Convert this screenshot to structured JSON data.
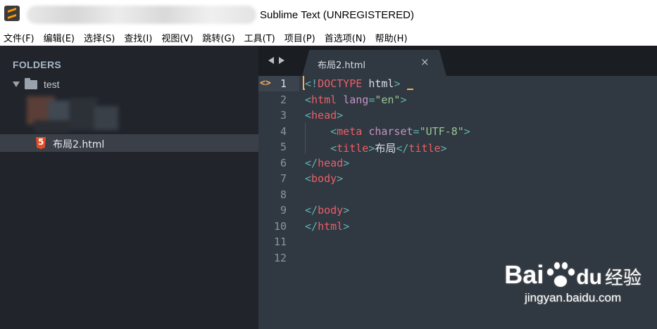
{
  "window": {
    "title": "Sublime Text (UNREGISTERED)"
  },
  "menu": [
    "文件(F)",
    "编辑(E)",
    "选择(S)",
    "查找(I)",
    "视图(V)",
    "跳转(G)",
    "工具(T)",
    "项目(P)",
    "首选项(N)",
    "帮助(H)"
  ],
  "sidebar": {
    "heading": "FOLDERS",
    "folder": "test",
    "file": "布局2.html"
  },
  "tab": {
    "label": "布局2.html",
    "close": "×"
  },
  "editor": {
    "current_line": 1,
    "marker": "<>",
    "line_numbers": [
      "1",
      "2",
      "3",
      "4",
      "5",
      "6",
      "7",
      "8",
      "9",
      "10",
      "11",
      "12"
    ],
    "lines": [
      "<!DOCTYPE html>",
      "<html lang=\"en\">",
      "<head>",
      "    <meta charset=\"UTF-8\">",
      "    <title>布局</title>",
      "</head>",
      "<body>",
      "",
      "</body>",
      "</html>",
      "",
      ""
    ]
  },
  "watermark": {
    "brand": "Bai",
    "brand2": "du",
    "cn": "经验",
    "url": "jingyan.baidu.com"
  },
  "colors": {
    "punct": "#5fb3b3",
    "tag": "#ec5f67",
    "attr": "#c594c5",
    "string": "#99c794",
    "accent": "#f9ae58"
  }
}
